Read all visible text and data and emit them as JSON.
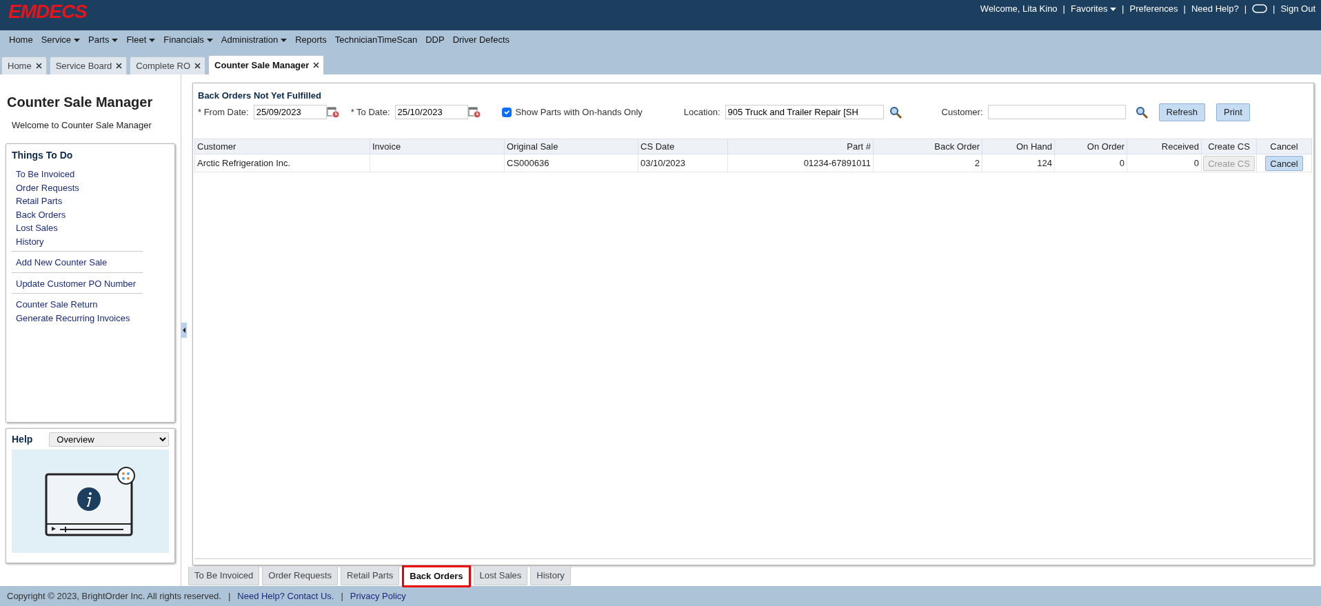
{
  "header": {
    "logo": "EMDECS",
    "items": [
      {
        "kind": "text",
        "label": "Welcome, Lita Kino"
      },
      {
        "kind": "separator",
        "label": "|"
      },
      {
        "kind": "link",
        "label": "Favorites",
        "dropdown": true
      },
      {
        "kind": "separator",
        "label": "|"
      },
      {
        "kind": "link",
        "label": "Preferences",
        "dropdown": false
      },
      {
        "kind": "separator",
        "label": "|"
      },
      {
        "kind": "link",
        "label": "Need Help?",
        "dropdown": false
      },
      {
        "kind": "separator",
        "label": "|"
      },
      {
        "kind": "chat"
      },
      {
        "kind": "separator",
        "label": "|"
      },
      {
        "kind": "link",
        "label": "Sign Out",
        "dropdown": false
      }
    ]
  },
  "menu": [
    {
      "label": "Home",
      "dropdown": false
    },
    {
      "label": "Service",
      "dropdown": true
    },
    {
      "label": "Parts",
      "dropdown": true
    },
    {
      "label": "Fleet",
      "dropdown": true
    },
    {
      "label": "Financials",
      "dropdown": true
    },
    {
      "label": "Administration",
      "dropdown": true
    },
    {
      "label": "Reports",
      "dropdown": false
    },
    {
      "label": "TechnicianTimeScan",
      "dropdown": false
    },
    {
      "label": "DDP",
      "dropdown": false
    },
    {
      "label": "Driver Defects",
      "dropdown": false
    }
  ],
  "doc_tabs": [
    {
      "label": "Home",
      "selected": false
    },
    {
      "label": "Service Board",
      "selected": false
    },
    {
      "label": "Complete RO",
      "selected": false
    },
    {
      "label": "Counter Sale Manager",
      "selected": true
    }
  ],
  "sidebar": {
    "title": "Counter Sale Manager",
    "welcome": "Welcome to Counter Sale Manager",
    "todo": {
      "title": "Things To Do",
      "groups": [
        [
          "To Be Invoiced",
          "Order Requests",
          "Retail Parts",
          "Back Orders",
          "Lost Sales",
          "History"
        ],
        [
          "Add New Counter Sale"
        ],
        [
          "Update Customer PO Number"
        ],
        [
          "Counter Sale Return",
          "Generate Recurring Invoices"
        ]
      ]
    },
    "help": {
      "label": "Help",
      "topic": "Overview"
    }
  },
  "main": {
    "title": "Back Orders Not Yet Fulfilled",
    "from_label": "* From Date:",
    "from_value": "25/09/2023",
    "to_label": "* To Date:",
    "to_value": "25/10/2023",
    "onhand_label": "Show Parts with On-hands Only",
    "onhand_checked": true,
    "location_label": "Location:",
    "location_value": "905 Truck and Trailer Repair [SH",
    "customer_label": "Customer:",
    "buttons": [
      "Refresh",
      "Print"
    ],
    "table": {
      "columns": [
        {
          "label": "Customer",
          "kind": "text"
        },
        {
          "label": "Invoice",
          "kind": "text"
        },
        {
          "label": "Original Sale",
          "kind": "text"
        },
        {
          "label": "CS Date",
          "kind": "text"
        },
        {
          "label": "Part #",
          "kind": "number"
        },
        {
          "label": "Back Order",
          "kind": "number"
        },
        {
          "label": "On Hand",
          "kind": "number"
        },
        {
          "label": "On Order",
          "kind": "number"
        },
        {
          "label": "Received",
          "kind": "number"
        },
        {
          "label": "Create CS",
          "kind": "action"
        },
        {
          "label": "Cancel",
          "kind": "action"
        }
      ],
      "rows": [
        {
          "cells": [
            "Arctic Refrigeration Inc.",
            "",
            "CS000636",
            "03/10/2023",
            "01234-67891011",
            "2",
            "124",
            "0",
            "0"
          ],
          "create_cs": {
            "label": "Create CS",
            "disabled": true
          },
          "cancel": {
            "label": "Cancel",
            "disabled": false
          }
        }
      ]
    }
  },
  "bottom_tabs": [
    {
      "label": "To Be Invoiced",
      "selected": false
    },
    {
      "label": "Order Requests",
      "selected": false
    },
    {
      "label": "Retail Parts",
      "selected": false
    },
    {
      "label": "Back Orders",
      "selected": true
    },
    {
      "label": "Lost Sales",
      "selected": false
    },
    {
      "label": "History",
      "selected": false
    }
  ],
  "footer": {
    "items": [
      {
        "kind": "text",
        "label": "Copyright © 2023, BrightOrder Inc. All rights reserved."
      },
      {
        "kind": "separator",
        "label": "|"
      },
      {
        "kind": "link",
        "label": "Need Help? Contact Us."
      },
      {
        "kind": "separator",
        "label": "|"
      },
      {
        "kind": "link",
        "label": "Privacy Policy"
      }
    ]
  }
}
